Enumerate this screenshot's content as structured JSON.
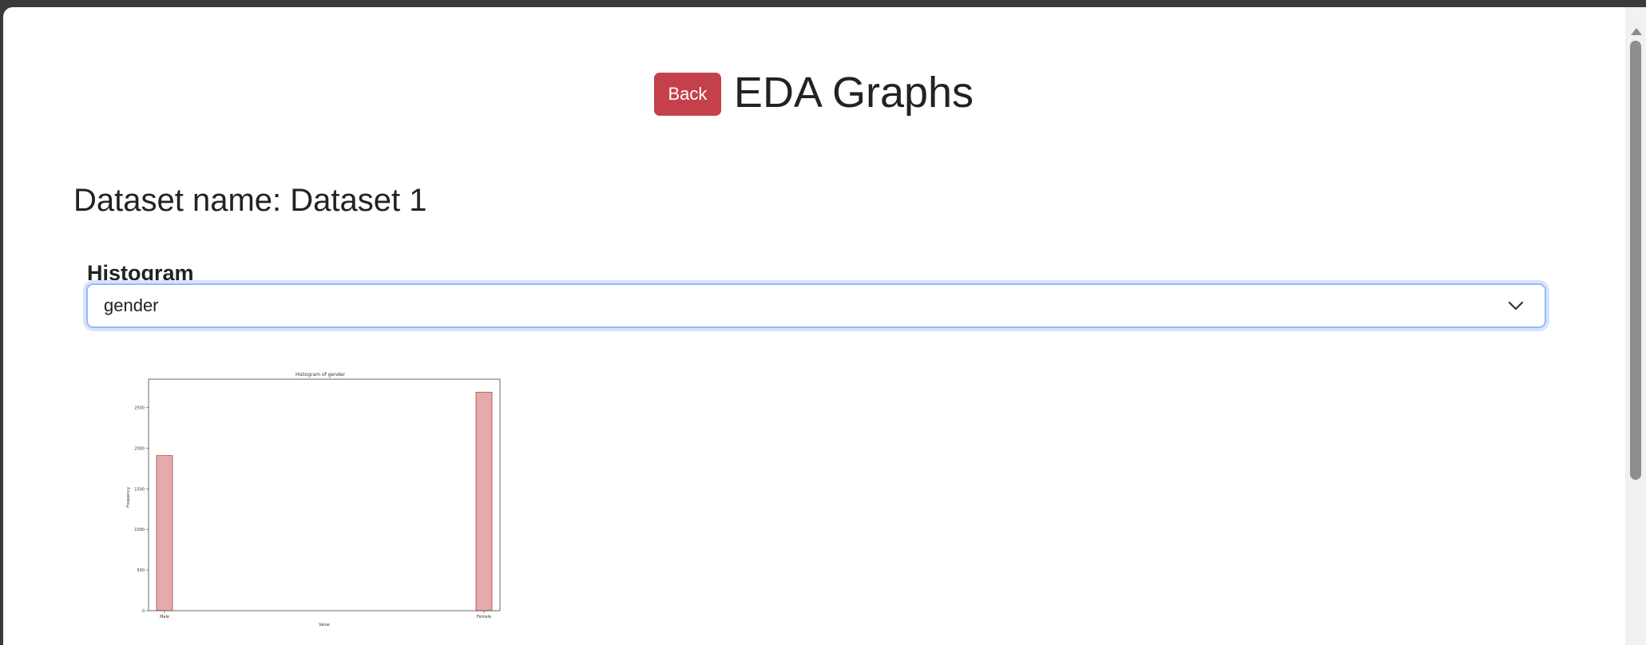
{
  "header": {
    "back_label": "Back",
    "title": "EDA Graphs"
  },
  "dataset": {
    "title": "Dataset name: Dataset 1"
  },
  "histogram": {
    "label": "Histogram",
    "selected": "gender"
  },
  "chart_data": {
    "type": "bar",
    "title": "Histogram of gender",
    "xlabel": "Value",
    "ylabel": "Frequency",
    "categories": [
      "Male",
      "Female"
    ],
    "values": [
      1910,
      2690
    ],
    "ylim": [
      0,
      2850
    ],
    "yticks": [
      0,
      500,
      1000,
      1500,
      2000,
      2500
    ],
    "grid": false,
    "bar_color": "#e6aaaa",
    "bar_edge_color": "#a05050"
  },
  "colors": {
    "accent_danger": "#c4404a",
    "focus_ring": "#9ab8ef"
  }
}
